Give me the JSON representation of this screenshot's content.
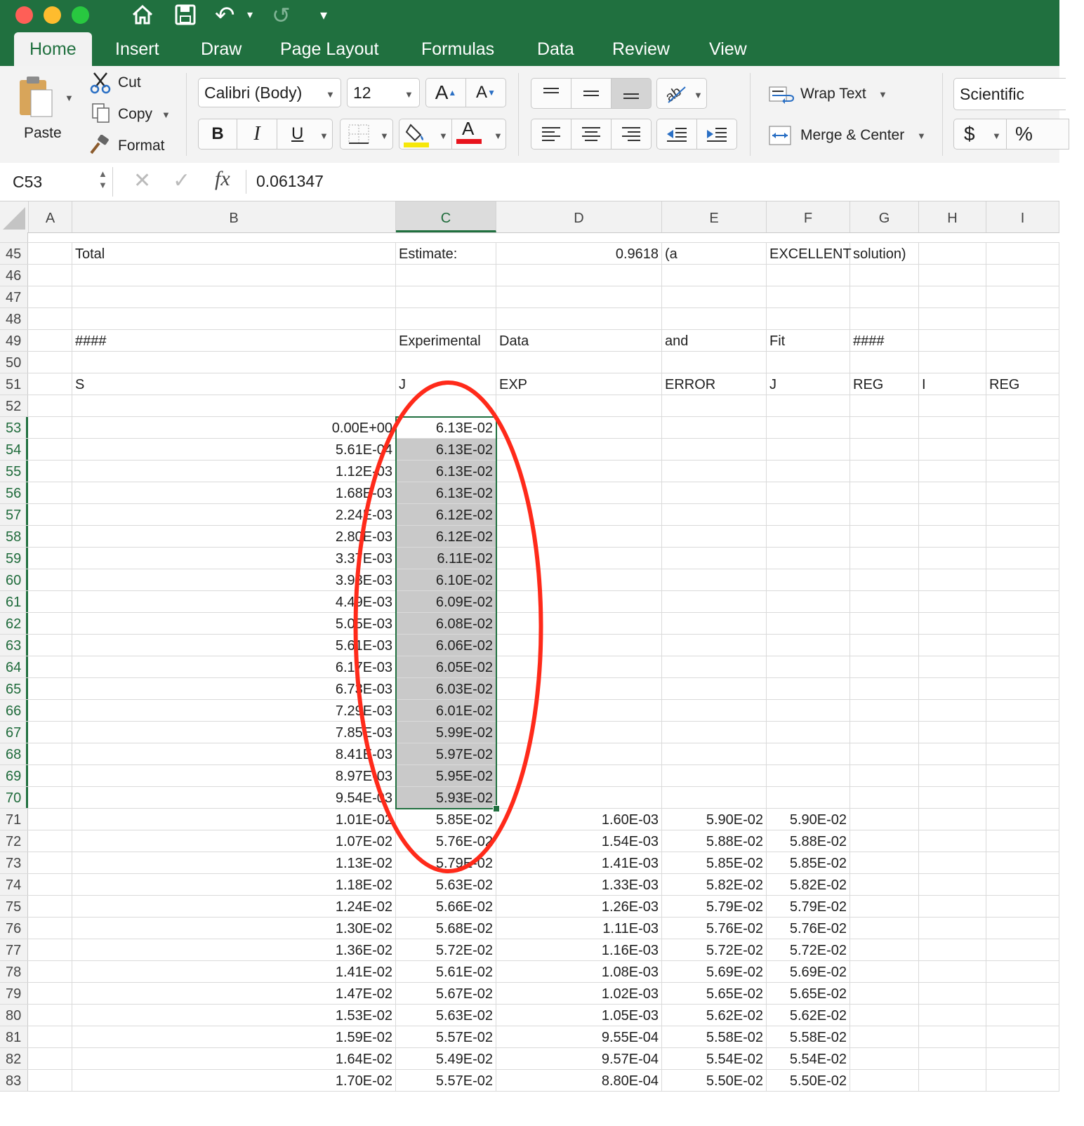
{
  "quick_access": {
    "undo_glyph": "↶",
    "redo_glyph": "↺",
    "more_glyph": "▾"
  },
  "tabs": [
    "Home",
    "Insert",
    "Draw",
    "Page Layout",
    "Formulas",
    "Data",
    "Review",
    "View"
  ],
  "clipboard": {
    "paste": "Paste",
    "cut": "Cut",
    "copy": "Copy",
    "format": "Format"
  },
  "font": {
    "name": "Calibri (Body)",
    "size": "12",
    "bold": "B",
    "italic": "I",
    "underline": "U",
    "grow": "A",
    "shrink": "A",
    "color_letter": "A",
    "fill_color": "#f6e70a",
    "font_color": "#e8141d"
  },
  "alignment": {
    "wrap_text": "Wrap Text",
    "merge_center": "Merge & Center"
  },
  "number": {
    "format": "Scientific",
    "currency": "$",
    "percent": "%"
  },
  "formula_bar": {
    "name_box": "C53",
    "cancel": "✕",
    "enter": "✓",
    "fx": "fx",
    "value": "0.061347"
  },
  "columns": [
    "A",
    "B",
    "C",
    "D",
    "E",
    "F",
    "G",
    "H",
    "I"
  ],
  "selected_column": "C",
  "rows": [
    {
      "n": "45",
      "cells": {
        "B": "Total",
        "C": "Estimate:",
        "D": "0.9618",
        "E": "(a",
        "F": "EXCELLENT",
        "G": "solution)"
      }
    },
    {
      "n": "46",
      "cells": {}
    },
    {
      "n": "47",
      "cells": {}
    },
    {
      "n": "48",
      "cells": {}
    },
    {
      "n": "49",
      "cells": {
        "B": "####",
        "C": "Experimental",
        "D": "Data",
        "E": "and",
        "F": "Fit",
        "G": "####"
      }
    },
    {
      "n": "50",
      "cells": {}
    },
    {
      "n": "51",
      "cells": {
        "B": "S",
        "C": "J",
        "D": "EXP",
        "E": "ERROR",
        "F": "J",
        "G": "REG",
        "H": "I",
        "I": "REG"
      }
    },
    {
      "n": "52",
      "cells": {}
    },
    {
      "n": "53",
      "cells": {
        "B": "0.00E+00",
        "C": "6.13E-02"
      }
    },
    {
      "n": "54",
      "cells": {
        "B": "5.61E-04",
        "C": "6.13E-02"
      }
    },
    {
      "n": "55",
      "cells": {
        "B": "1.12E-03",
        "C": "6.13E-02"
      }
    },
    {
      "n": "56",
      "cells": {
        "B": "1.68E-03",
        "C": "6.13E-02"
      }
    },
    {
      "n": "57",
      "cells": {
        "B": "2.24E-03",
        "C": "6.12E-02"
      }
    },
    {
      "n": "58",
      "cells": {
        "B": "2.80E-03",
        "C": "6.12E-02"
      }
    },
    {
      "n": "59",
      "cells": {
        "B": "3.37E-03",
        "C": "6.11E-02"
      }
    },
    {
      "n": "60",
      "cells": {
        "B": "3.93E-03",
        "C": "6.10E-02"
      }
    },
    {
      "n": "61",
      "cells": {
        "B": "4.49E-03",
        "C": "6.09E-02"
      }
    },
    {
      "n": "62",
      "cells": {
        "B": "5.05E-03",
        "C": "6.08E-02"
      }
    },
    {
      "n": "63",
      "cells": {
        "B": "5.61E-03",
        "C": "6.06E-02"
      }
    },
    {
      "n": "64",
      "cells": {
        "B": "6.17E-03",
        "C": "6.05E-02"
      }
    },
    {
      "n": "65",
      "cells": {
        "B": "6.73E-03",
        "C": "6.03E-02"
      }
    },
    {
      "n": "66",
      "cells": {
        "B": "7.29E-03",
        "C": "6.01E-02"
      }
    },
    {
      "n": "67",
      "cells": {
        "B": "7.85E-03",
        "C": "5.99E-02"
      }
    },
    {
      "n": "68",
      "cells": {
        "B": "8.41E-03",
        "C": "5.97E-02"
      }
    },
    {
      "n": "69",
      "cells": {
        "B": "8.97E-03",
        "C": "5.95E-02"
      }
    },
    {
      "n": "70",
      "cells": {
        "B": "9.54E-03",
        "C": "5.93E-02"
      }
    },
    {
      "n": "71",
      "cells": {
        "B": "1.01E-02",
        "C": "5.85E-02",
        "D": "1.60E-03",
        "E": "5.90E-02",
        "F": "5.90E-02"
      }
    },
    {
      "n": "72",
      "cells": {
        "B": "1.07E-02",
        "C": "5.76E-02",
        "D": "1.54E-03",
        "E": "5.88E-02",
        "F": "5.88E-02"
      }
    },
    {
      "n": "73",
      "cells": {
        "B": "1.13E-02",
        "C": "5.79E-02",
        "D": "1.41E-03",
        "E": "5.85E-02",
        "F": "5.85E-02"
      }
    },
    {
      "n": "74",
      "cells": {
        "B": "1.18E-02",
        "C": "5.63E-02",
        "D": "1.33E-03",
        "E": "5.82E-02",
        "F": "5.82E-02"
      }
    },
    {
      "n": "75",
      "cells": {
        "B": "1.24E-02",
        "C": "5.66E-02",
        "D": "1.26E-03",
        "E": "5.79E-02",
        "F": "5.79E-02"
      }
    },
    {
      "n": "76",
      "cells": {
        "B": "1.30E-02",
        "C": "5.68E-02",
        "D": "1.11E-03",
        "E": "5.76E-02",
        "F": "5.76E-02"
      }
    },
    {
      "n": "77",
      "cells": {
        "B": "1.36E-02",
        "C": "5.72E-02",
        "D": "1.16E-03",
        "E": "5.72E-02",
        "F": "5.72E-02"
      }
    },
    {
      "n": "78",
      "cells": {
        "B": "1.41E-02",
        "C": "5.61E-02",
        "D": "1.08E-03",
        "E": "5.69E-02",
        "F": "5.69E-02"
      }
    },
    {
      "n": "79",
      "cells": {
        "B": "1.47E-02",
        "C": "5.67E-02",
        "D": "1.02E-03",
        "E": "5.65E-02",
        "F": "5.65E-02"
      }
    },
    {
      "n": "80",
      "cells": {
        "B": "1.53E-02",
        "C": "5.63E-02",
        "D": "1.05E-03",
        "E": "5.62E-02",
        "F": "5.62E-02"
      }
    },
    {
      "n": "81",
      "cells": {
        "B": "1.59E-02",
        "C": "5.57E-02",
        "D": "9.55E-04",
        "E": "5.58E-02",
        "F": "5.58E-02"
      }
    },
    {
      "n": "82",
      "cells": {
        "B": "1.64E-02",
        "C": "5.49E-02",
        "D": "9.57E-04",
        "E": "5.54E-02",
        "F": "5.54E-02"
      }
    },
    {
      "n": "83",
      "cells": {
        "B": "1.70E-02",
        "C": "5.57E-02",
        "D": "8.80E-04",
        "E": "5.50E-02",
        "F": "5.50E-02"
      }
    }
  ],
  "selection": {
    "start_row": "53",
    "end_row": "70",
    "column": "C"
  },
  "colors": {
    "ribbon_green": "#20703f",
    "annotation_red": "#ff2a1a",
    "selection_fill": "#c9c9c9"
  }
}
